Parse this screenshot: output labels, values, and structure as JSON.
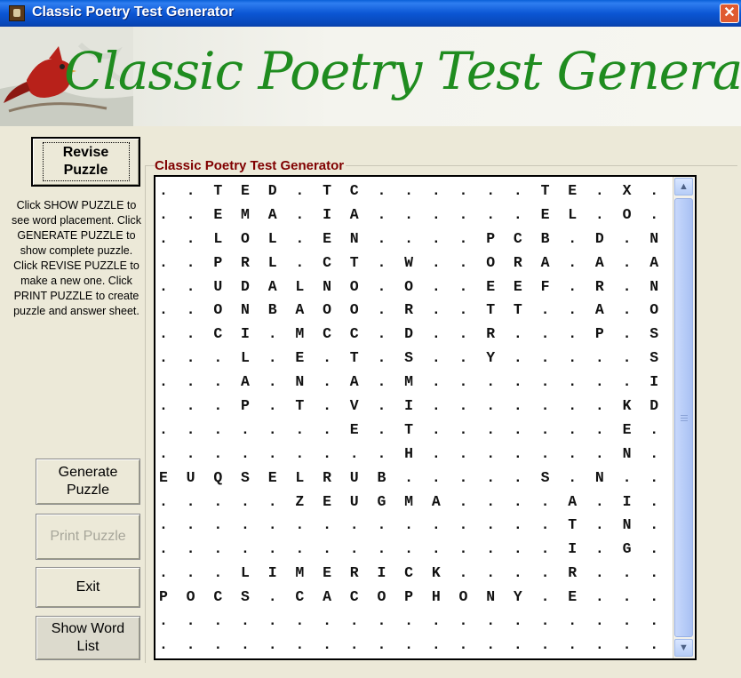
{
  "window": {
    "title": "Classic Poetry Test Generator",
    "close_glyph": "✕",
    "icon": "cardinal-app-icon"
  },
  "banner": {
    "title": "Classic Poetry Test Generator",
    "image": "cardinal-bird-illustration"
  },
  "buttons": {
    "revise": "Revise Puzzle",
    "generate": "Generate Puzzle",
    "print": "Print Puzzle",
    "exit": "Exit",
    "show_word_list": "Show Word List"
  },
  "instructions": "Click SHOW PUZZLE to see word placement. Click GENERATE PUZZLE to show complete puzzle. Click REVISE PUZZLE to make a new one.  Click PRINT PUZZLE to create puzzle and answer sheet.",
  "group": {
    "label": "Classic Poetry Test Generator"
  },
  "puzzle_rows": [
    ". . T E D . T C . . . . . . T E . X . E .",
    ". . E M A . I A . . . . . . E L . O . C .",
    ". . L O L . E N . . . . P C B . D . N .",
    ". . P R L . C T . W . . O R A . A . A .",
    ". . U D A L N O . O . . E E F . R . N .",
    ". . O N B A O O . R . . T T . . A . O .",
    ". . C I . M C C . D . . R . . . P . S .",
    ". . . L . E . T . S . . Y . . . . . S .",
    ". . . A . N . A . M . . . . . . . . I .",
    ". . . P . T . V . I . . . . . . . K D .",
    ". . . . . . . E . T . . . . . . . E . .",
    ". . . . . . . . . H . . . . . . . N . .",
    "E U Q S E L R U B . . . . . S . N . .",
    ". . . . . Z E U G M A . . . . A . I . .",
    ". . . . . . . . . . . . . . . T . N . .",
    ". . . . . . . . . . . . . . . I . G . .",
    ". . . L I M E R I C K . . . . R . . . .",
    "P O C S . C A C O P H O N Y . E . . . .",
    ". . . . . . . . . . . . . . . . . . . .",
    ". . . . . . . . . . . . . . . . . . . ."
  ],
  "scrollbar": {
    "up_arrow": "▲",
    "down_arrow": "▼"
  },
  "colors": {
    "title_bar": "#0a5fd8",
    "banner_text": "#1f8c1f",
    "group_label": "#800000",
    "window_bg": "#ece9d8"
  }
}
